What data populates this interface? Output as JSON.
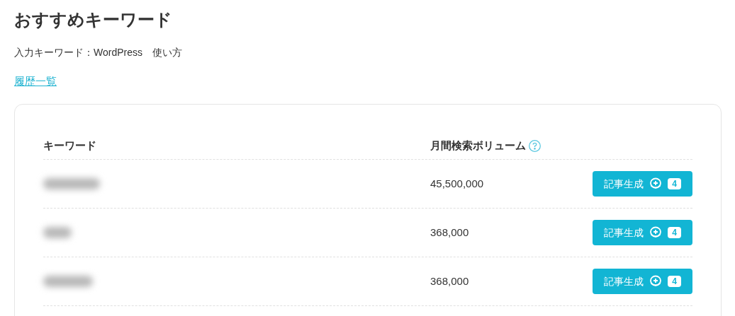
{
  "title": "おすすめキーワード",
  "input_keyword": "入力キーワード：WordPress　使い方",
  "history_link": "履歴一覧",
  "table": {
    "columns": [
      "キーワード",
      "月間検索ボリューム"
    ],
    "rows": [
      {
        "volume": "45,500,000",
        "button": "記事生成",
        "cost": "4"
      },
      {
        "volume": "368,000",
        "button": "記事生成",
        "cost": "4"
      },
      {
        "volume": "368,000",
        "button": "記事生成",
        "cost": "4"
      }
    ]
  }
}
